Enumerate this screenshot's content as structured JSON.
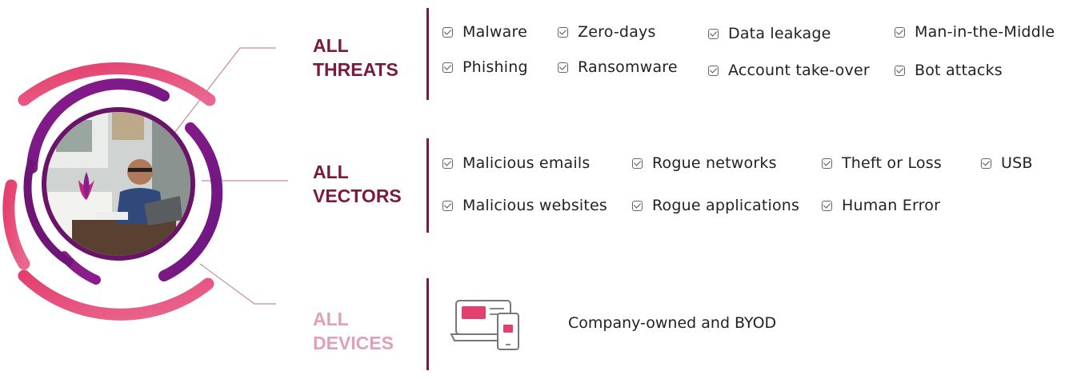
{
  "colors": {
    "heading": "#7b1a3c",
    "heading_devices": "#e0a0b8",
    "accent_bar": "#7b1a3c",
    "ring_pink": "#e0507a",
    "ring_purple": "#7a1890"
  },
  "icon_names": {
    "checkbox": "checkbox-checked-icon",
    "devices": "laptop-tablet-icon",
    "photo": "person-with-laptop-photo"
  },
  "sections": {
    "threats": {
      "heading_line1": "ALL",
      "heading_line2": "THREATS",
      "items": [
        "Malware",
        "Zero-days",
        "Data leakage",
        "Man-in-the-Middle",
        "Phishing",
        "Ransomware",
        "Account take-over",
        "Bot attacks"
      ]
    },
    "vectors": {
      "heading_line1": "ALL",
      "heading_line2": "VECTORS",
      "items": [
        "Malicious emails",
        "Rogue networks",
        "Theft or Loss",
        "USB",
        "Malicious websites",
        "Rogue applications",
        "Human Error"
      ]
    },
    "devices": {
      "heading_line1": "ALL",
      "heading_line2": "DEVICES",
      "text": "Company-owned and BYOD"
    }
  }
}
